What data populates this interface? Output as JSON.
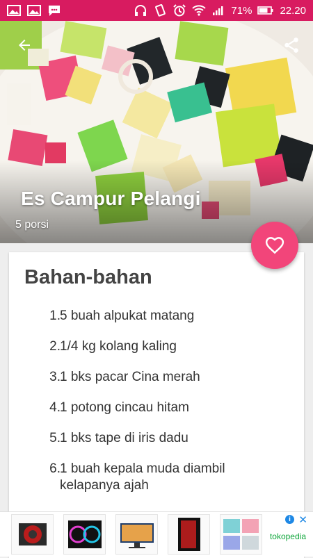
{
  "status_bar": {
    "battery_percent": "71%",
    "time": "22.20",
    "icons_left": [
      "image-icon",
      "image-icon",
      "chat-icon"
    ],
    "icons_right": [
      "headphones-icon",
      "vibrate-icon",
      "alarm-icon",
      "wifi-icon",
      "signal-icon",
      "battery-icon"
    ]
  },
  "recipe": {
    "title": "Es Campur Pelangi",
    "portions": "5 porsi",
    "section_title": "Bahan-bahan",
    "ingredients": [
      {
        "num": "1.",
        "text": "5 buah alpukat matang"
      },
      {
        "num": "2.",
        "text": "1/4 kg kolang kaling"
      },
      {
        "num": "3.",
        "text": "1 bks pacar Cina merah"
      },
      {
        "num": "4.",
        "text": "1 potong cincau hitam"
      },
      {
        "num": "5.",
        "text": "1 bks tape di iris dadu"
      },
      {
        "num": "6.",
        "text": "1 buah kepala muda diambil kelapanya ajah"
      }
    ]
  },
  "ad": {
    "brand": "tokopedia",
    "thumbnails": [
      "ad-product-cpu-cooler",
      "ad-product-rgb-fans",
      "ad-product-monitor",
      "ad-product-pc-case",
      "ad-product-pillows"
    ]
  },
  "colors": {
    "status_bar": "#d81b60",
    "fab": "#f2457a",
    "brand_green": "#0ea63a"
  }
}
